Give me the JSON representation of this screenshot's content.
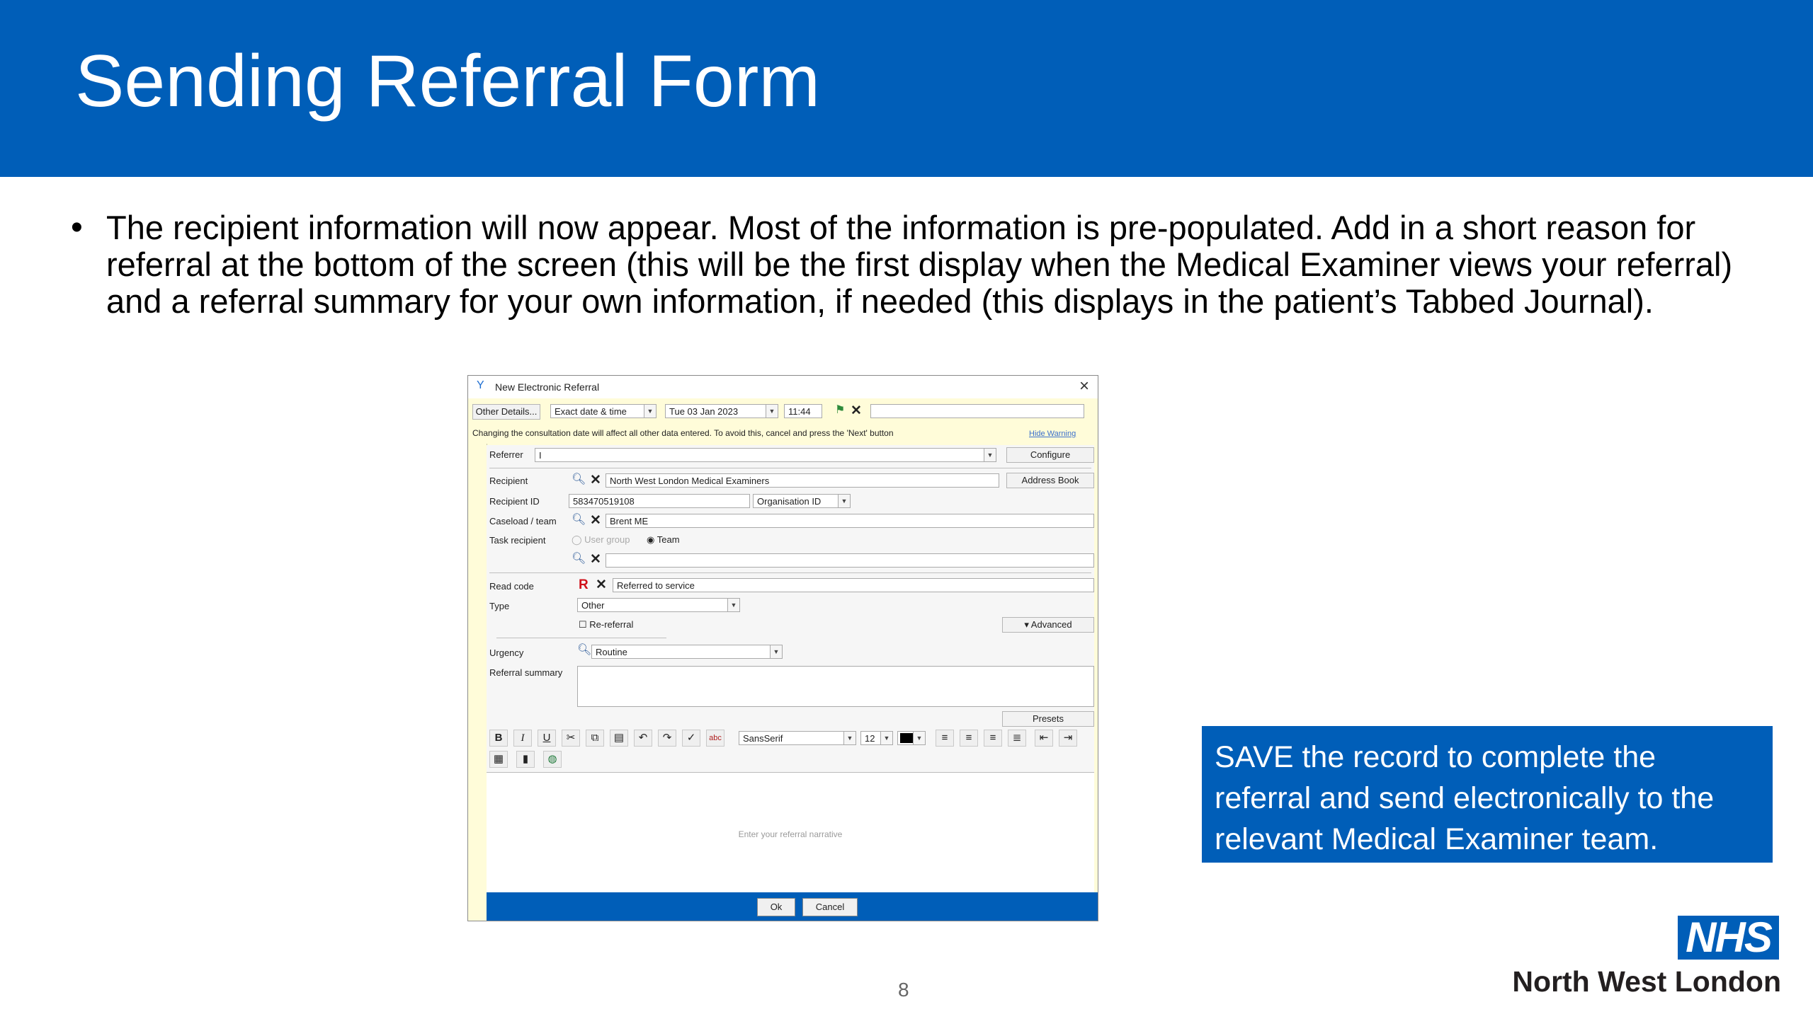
{
  "slide": {
    "title": "Sending Referral Form",
    "bullet": "The recipient information will now appear. Most of the information is pre-populated. Add in a short reason for referral at the bottom of the screen (this will be the first display when the Medical Examiner views your referral) and a referral summary for your own information, if needed (this displays in the patient’s Tabbed Journal).",
    "callout": "SAVE the record to complete the referral and send electronically to the relevant Medical Examiner team.",
    "page_number": "8",
    "logo_text": "NHS",
    "org_name": "North West London"
  },
  "dialog": {
    "title": "New Electronic Referral",
    "other_details": "Other Details...",
    "date_mode": "Exact date & time",
    "date": "Tue 03 Jan 2023",
    "time": "11:44",
    "warning": "Changing the consultation date will affect all other data entered. To avoid this, cancel and press the 'Next' button",
    "hide_warning": "Hide Warning",
    "referrer_label": "Referrer",
    "referrer_value": "I",
    "configure": "Configure",
    "recipient_label": "Recipient",
    "recipient_value": "North West London Medical Examiners",
    "address_book": "Address Book",
    "recipient_id_label": "Recipient ID",
    "recipient_id_value": "583470519108",
    "id_type": "Organisation ID",
    "caseload_label": "Caseload / team",
    "caseload_value": "Brent ME",
    "task_recipient_label": "Task recipient",
    "radio_user_group": "User group",
    "radio_team": "Team",
    "read_code_label": "Read code",
    "read_code_value": "Referred to service",
    "type_label": "Type",
    "type_value": "Other",
    "re_referral": "Re-referral",
    "advanced": "Advanced",
    "urgency_label": "Urgency",
    "urgency_value": "Routine",
    "summary_label": "Referral summary",
    "presets": "Presets",
    "font": "SansSerif",
    "font_size": "12",
    "narrative_placeholder": "Enter your referral narrative",
    "ok": "Ok",
    "cancel": "Cancel"
  },
  "colors": {
    "nhs_blue": "#005EB8",
    "dialog_bg": "#fffcd9"
  }
}
